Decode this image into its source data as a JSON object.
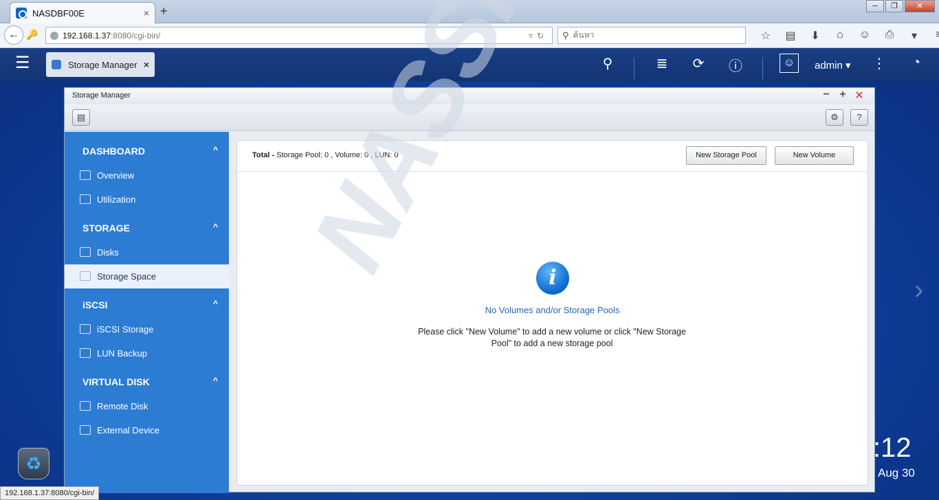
{
  "browser": {
    "tab_title": "NASDBF00E",
    "tab_close": "×",
    "new_tab": "+",
    "url_host": "192.168.1.37",
    "url_rest": ":8080/cgi-bin/",
    "search_placeholder": "ค้นหา",
    "status_url": "192.168.1.37:8080/cgi-bin/",
    "window_controls": [
      "─",
      "❐",
      "✕"
    ]
  },
  "qts": {
    "app_tab": "Storage Manager",
    "user": "admin ▾",
    "clock": ":12",
    "date": "Aug 30"
  },
  "window": {
    "title": "Storage Manager"
  },
  "sidebar": {
    "sections": [
      {
        "title": "DASHBOARD",
        "items": [
          "Overview",
          "Utilization"
        ]
      },
      {
        "title": "STORAGE",
        "items": [
          "Disks",
          "Storage Space"
        ]
      },
      {
        "title": "iSCSI",
        "items": [
          "iSCSI Storage",
          "LUN Backup"
        ]
      },
      {
        "title": "VIRTUAL DISK",
        "items": [
          "Remote Disk",
          "External Device"
        ]
      }
    ],
    "active_item": "Storage Space"
  },
  "content": {
    "total_label": "Total -",
    "summary": "Storage Pool: 0 , Volume: 0 , LUN: 0",
    "new_pool_button": "New Storage Pool",
    "new_volume_button": "New Volume",
    "empty_title": "No Volumes and/or Storage Pools",
    "empty_help": "Please click \"New Volume\" to add a new volume or click \"New Storage Pool\" to add a new storage pool"
  },
  "watermark": "NASSHOPS.net"
}
